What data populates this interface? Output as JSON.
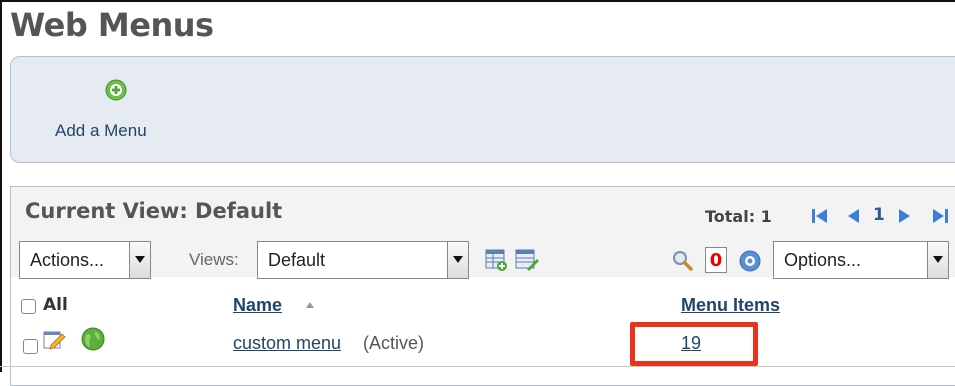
{
  "page": {
    "title": "Web Menus"
  },
  "toolbar": {
    "add_menu_label": "Add a Menu"
  },
  "grid": {
    "current_view": "Current View: Default",
    "total_label": "Total: 1",
    "page_number": "1",
    "actions_select": "Actions...",
    "views_label": "Views:",
    "views_select": "Default",
    "filter_count": "0",
    "options_select": "Options...",
    "columns": {
      "all": "All",
      "name": "Name",
      "menu_items": "Menu Items"
    },
    "rows": [
      {
        "name": "custom menu",
        "status": "(Active)",
        "menu_items": "19"
      }
    ]
  },
  "colors": {
    "link": "#24456b",
    "highlight": "#e8331e",
    "toolbar_bg": "#e6ebf2",
    "count_red": "#e00000"
  }
}
